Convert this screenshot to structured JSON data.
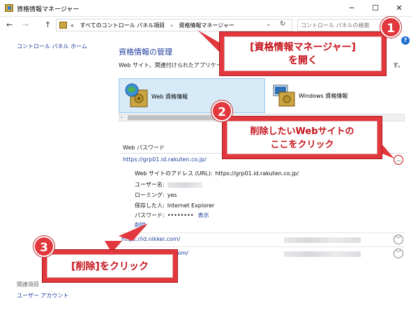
{
  "window": {
    "title": "資格情報マネージャー",
    "minimize": "─",
    "maximize": "☐",
    "close": "✕"
  },
  "nav": {
    "back": "←",
    "forward": "→",
    "up": "↑",
    "breadcrumb": [
      "«",
      "すべてのコントロール パネル項目",
      "›",
      "資格情報マネージャー"
    ],
    "dropdown": "⌄",
    "refresh": "↻",
    "search_placeholder": "コントロール パネルの検索",
    "search_icon": "⌕"
  },
  "help": "?",
  "left": {
    "home_link": "コントロール パネル ホーム",
    "related_heading": "関連項目",
    "related_item": "ユーザー アカウント"
  },
  "main": {
    "title": "資格情報の管理",
    "desc": "Web サイト、関連付けられたアプリケーシ",
    "desc_tail": "す。",
    "tabs": [
      {
        "label": "Web 資格情報",
        "selected": true
      },
      {
        "label": "Windows 資格情報",
        "selected": false
      }
    ],
    "scroll_left": "‹",
    "section_heading": "Web パスワード",
    "entries": [
      {
        "url": "https://grp01.id.rakuten.co.jp/",
        "expanded": true,
        "chevron": "︿"
      },
      {
        "url": "https://id.nikkei.com/",
        "expanded": false,
        "chevron": "﹀"
      },
      {
        "url": "ok.com/",
        "expanded": false,
        "chevron": "﹀"
      }
    ],
    "details": {
      "address_label": "Web サイトのアドレス (URL):",
      "address_value": "https://grp01.id.rakuten.co.jp/",
      "user_label": "ユーザー名:",
      "roaming_label": "ローミング:",
      "roaming_value": "yes",
      "saved_by_label": "保存した人:",
      "saved_by_value": "Internet Explorer",
      "password_label": "パスワード:",
      "password_value": "••••••••",
      "show_link": "表示",
      "delete_link": "削除"
    }
  },
  "callouts": [
    {
      "number": "1",
      "text_line1": "[資格情報マネージャー]",
      "text_line2": "を開く"
    },
    {
      "number": "2",
      "text_line1": "削除したいWebサイトの",
      "text_line2": "ここをクリック"
    },
    {
      "number": "3",
      "text_line1": "[削除]をクリック"
    }
  ],
  "colors": {
    "callout_red": "#e2373c",
    "link_blue": "#1e3f9e",
    "title_blue": "#1e3a9e",
    "selected_tab": "#d6eaf8"
  }
}
